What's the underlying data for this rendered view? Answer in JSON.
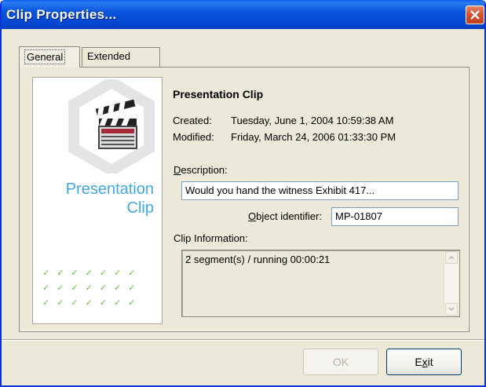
{
  "window": {
    "title": "Clip Properties...",
    "close_icon": "close-icon"
  },
  "tabs": [
    {
      "label": "General",
      "selected": true
    },
    {
      "label": "Extended",
      "selected": false
    }
  ],
  "preview": {
    "title_line1": "Presentation",
    "title_line2": "Clip",
    "icon": "clapperboard-icon",
    "checks_row": "✓✓✓✓✓✓✓"
  },
  "info": {
    "title": "Presentation Clip",
    "created_label": "Created:",
    "created_value": "Tuesday, June 1, 2004  10:59:38 AM",
    "modified_label": "Modified:",
    "modified_value": "Friday, March 24, 2006  01:33:30 PM",
    "description_label_ul": "D",
    "description_label_rest": "escription:",
    "description_value": "Would you hand the witness Exhibit 417...",
    "object_id_label_ul": "O",
    "object_id_label_rest": "bject identifier:",
    "object_id_value": "MP-01807",
    "clip_info_label": "Clip Information:",
    "clip_info_value": "2 segment(s) / running 00:00:21"
  },
  "buttons": {
    "ok": "OK",
    "exit_pre": "E",
    "exit_ul": "x",
    "exit_post": "it"
  },
  "colors": {
    "titlebar": "#0a55dc",
    "preview_title": "#3fa9e6",
    "checks": "#5fbf3a"
  }
}
